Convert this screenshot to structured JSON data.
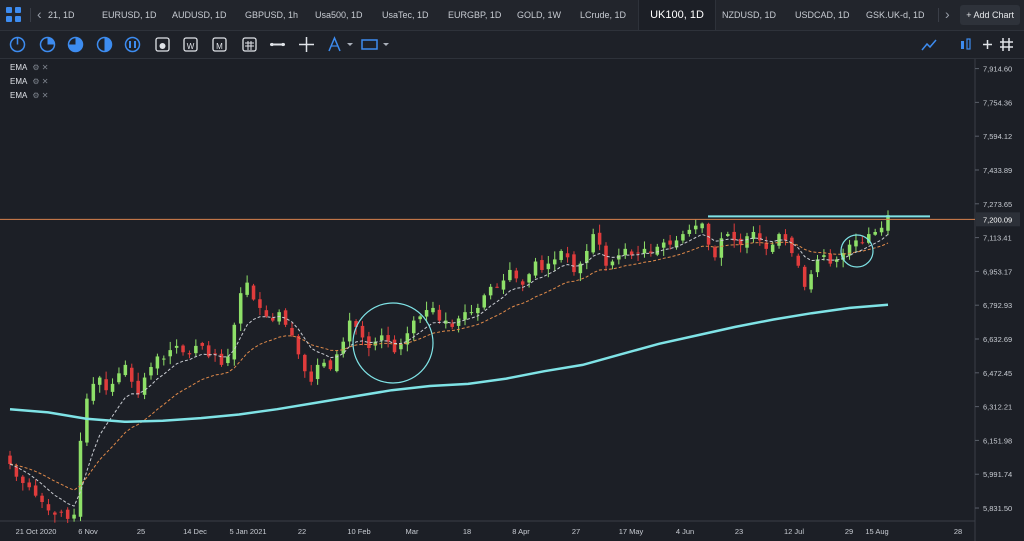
{
  "tabs": {
    "items": [
      {
        "label": "21, 1D"
      },
      {
        "label": "EURUSD, 1D"
      },
      {
        "label": "AUDUSD, 1D"
      },
      {
        "label": "GBPUSD, 1h"
      },
      {
        "label": "Usa500, 1D"
      },
      {
        "label": "UsaTec, 1D"
      },
      {
        "label": "EURGBP, 1D"
      },
      {
        "label": "GOLD, 1W"
      },
      {
        "label": "LCrude, 1D"
      },
      {
        "label": "UK100, 1D",
        "active": true
      },
      {
        "label": "NZDUSD, 1D"
      },
      {
        "label": "USDCAD, 1D"
      },
      {
        "label": "GSK.UK-d, 1D"
      }
    ],
    "add_chart": "Add Chart"
  },
  "toolbar": {
    "icons": [
      "pie-quarter-icon",
      "pie-half-icon",
      "pie-three-quarter-icon",
      "half-circle-icon",
      "circle-bars-icon",
      "target-icon",
      "calendar-w-icon",
      "calendar-m-icon",
      "calendar-grid-icon",
      "horizontal-line-icon",
      "crosshair-icon",
      "triangle-a-icon",
      "rectangle-icon"
    ],
    "right_icons": [
      "line-indicator-icon",
      "bar-settings-icon",
      "plus-icon",
      "hash-grid-icon"
    ]
  },
  "indicators": [
    "EMA",
    "EMA",
    "EMA"
  ],
  "colors": {
    "up": "#8ee068",
    "down": "#e03c3c",
    "ema_long": "#7fe3e6",
    "ema_fast": "#c9ccd2",
    "ema_slow": "#e08a4a",
    "resistance": "#d9824e",
    "price_tag": "#2c3038"
  },
  "chart_data": {
    "type": "candlestick",
    "symbol": "UK100, 1D",
    "y_ticks": [
      7914.6,
      7754.36,
      7594.12,
      7433.89,
      7273.65,
      7113.41,
      6953.17,
      6792.93,
      6632.69,
      6472.45,
      6312.21,
      6151.98,
      5991.74,
      5831.5
    ],
    "y_tick_labels": [
      "7,914.60",
      "7,754.36",
      "7,594.12",
      "7,433.89",
      "7,273.65",
      "7,113.41",
      "6,953.17",
      "6,792.93",
      "6,632.69",
      "6,472.45",
      "6,312.21",
      "6,151.98",
      "5,991.74",
      "5,831.50"
    ],
    "ylim": [
      5770,
      7960
    ],
    "x_tick_labels": [
      "21 Oct 2020",
      "6 Nov",
      "25",
      "14 Dec",
      "5 Jan 2021",
      "22",
      "10 Feb",
      "Mar",
      "18",
      "8 Apr",
      "27",
      "17 May",
      "4 Jun",
      "23",
      "12 Jul",
      "29",
      "15 Aug",
      "28"
    ],
    "last_price": 7200.09,
    "last_price_label": "7,200.09",
    "resistance_level": 7200,
    "long_ema": [
      6300,
      6285,
      6255,
      6240,
      6245,
      6258,
      6275,
      6300,
      6330,
      6360,
      6390,
      6410,
      6420,
      6445,
      6480,
      6510,
      6560,
      6610,
      6650,
      6690,
      6725,
      6755,
      6780,
      6795
    ],
    "closes": [
      6040,
      5980,
      5950,
      5930,
      5890,
      5860,
      5820,
      5800,
      5810,
      5780,
      5800,
      6150,
      6350,
      6420,
      6450,
      6390,
      6420,
      6470,
      6510,
      6430,
      6370,
      6450,
      6500,
      6550,
      6540,
      6580,
      6600,
      6570,
      6560,
      6600,
      6600,
      6550,
      6560,
      6510,
      6550,
      6700,
      6850,
      6900,
      6820,
      6780,
      6740,
      6720,
      6760,
      6700,
      6650,
      6560,
      6480,
      6430,
      6510,
      6520,
      6490,
      6560,
      6620,
      6720,
      6690,
      6640,
      6590,
      6620,
      6650,
      6620,
      6570,
      6610,
      6660,
      6720,
      6740,
      6770,
      6780,
      6720,
      6720,
      6690,
      6730,
      6760,
      6760,
      6780,
      6840,
      6880,
      6880,
      6910,
      6960,
      6920,
      6890,
      6940,
      7000,
      6960,
      6990,
      7010,
      7050,
      7020,
      6950,
      6990,
      7050,
      7130,
      7080,
      6980,
      7000,
      7030,
      7060,
      7030,
      7040,
      7060,
      7040,
      7070,
      7090,
      7080,
      7100,
      7130,
      7150,
      7170,
      7180,
      7080,
      7020,
      7110,
      7130,
      7100,
      7080,
      7120,
      7140,
      7100,
      7060,
      7080,
      7130,
      7100,
      7040,
      6980,
      6880,
      6940,
      7010,
      7030,
      6990,
      7010,
      7040,
      7080,
      7100,
      7090,
      7130,
      7140,
      7160,
      7220
    ]
  }
}
